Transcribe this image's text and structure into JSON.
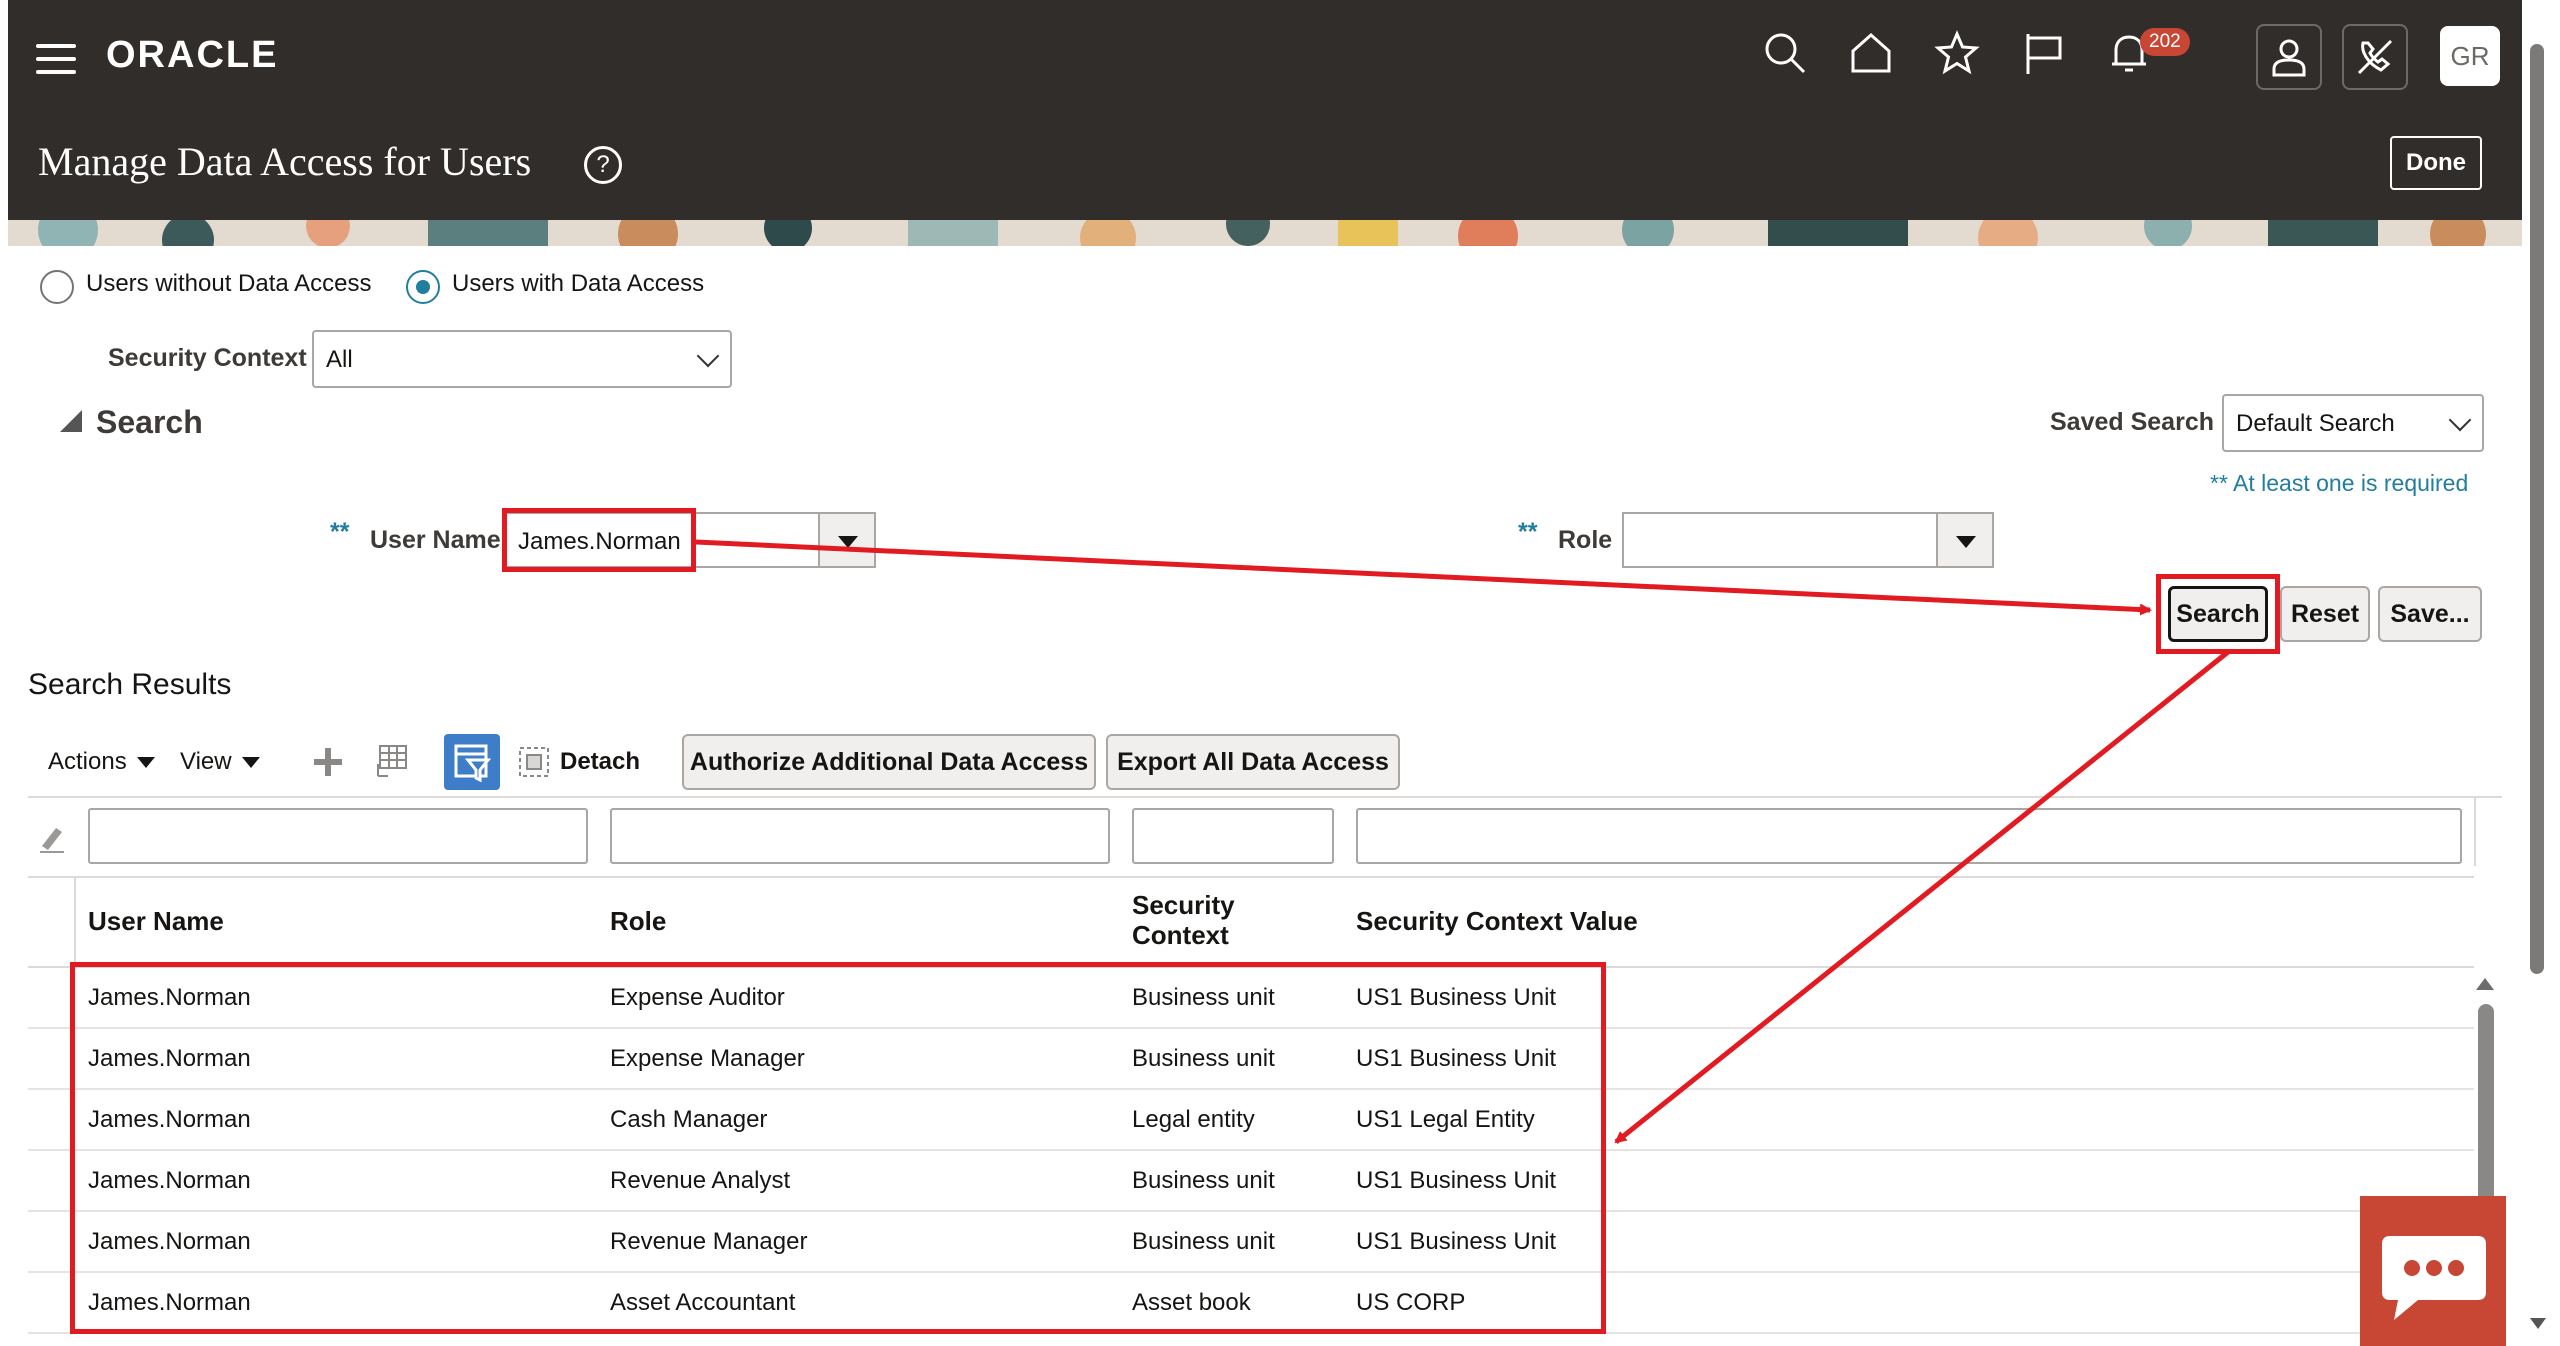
{
  "header": {
    "brand": "ORACLE",
    "notification_count": "202",
    "avatar_initials": "GR",
    "page_title": "Manage Data Access for Users",
    "done_label": "Done"
  },
  "filters": {
    "radio_without": "Users without Data Access",
    "radio_with": "Users with Data Access",
    "selected": "Users with Data Access",
    "security_context_label": "Security Context",
    "security_context_value": "All"
  },
  "search": {
    "title": "Search",
    "saved_search_label": "Saved Search",
    "saved_search_value": "Default Search",
    "required_note": "** At least one is required",
    "required_mark": "**",
    "user_name_label": "User Name",
    "user_name_value": "James.Norman",
    "role_label": "Role",
    "role_value": "",
    "search_button": "Search",
    "reset_button": "Reset",
    "save_button": "Save..."
  },
  "results": {
    "title": "Search Results",
    "actions_label": "Actions",
    "view_label": "View",
    "detach_label": "Detach",
    "authorize_button": "Authorize Additional Data Access",
    "export_button": "Export All Data Access",
    "columns": {
      "user_name": "User Name",
      "role": "Role",
      "security_context_line1": "Security",
      "security_context_line2": "Context",
      "security_context_value": "Security Context Value"
    },
    "rows": [
      {
        "user": "James.Norman",
        "role": "Expense Auditor",
        "context": "Business unit",
        "value": "US1 Business Unit"
      },
      {
        "user": "James.Norman",
        "role": "Expense Manager",
        "context": "Business unit",
        "value": "US1 Business Unit"
      },
      {
        "user": "James.Norman",
        "role": "Cash Manager",
        "context": "Legal entity",
        "value": "US1 Legal Entity"
      },
      {
        "user": "James.Norman",
        "role": "Revenue Analyst",
        "context": "Business unit",
        "value": "US1 Business Unit"
      },
      {
        "user": "James.Norman",
        "role": "Revenue Manager",
        "context": "Business unit",
        "value": "US1 Business Unit"
      },
      {
        "user": "James.Norman",
        "role": "Asset Accountant",
        "context": "Asset book",
        "value": "US CORP"
      }
    ]
  },
  "colors": {
    "header_bg": "#312d2a",
    "annotation_red": "#e21b22",
    "accent_teal": "#227e9e",
    "chat_bg": "#c74634",
    "filter_icon_bg": "#3e7ec9"
  },
  "icons": [
    "menu-icon",
    "search-icon",
    "home-icon",
    "star-icon",
    "flag-icon",
    "bell-icon",
    "user-icon",
    "phone-off-icon",
    "help-icon",
    "add-icon",
    "freeze-icon",
    "query-by-example-icon",
    "detach-icon",
    "clear-filter-icon",
    "chat-icon"
  ]
}
